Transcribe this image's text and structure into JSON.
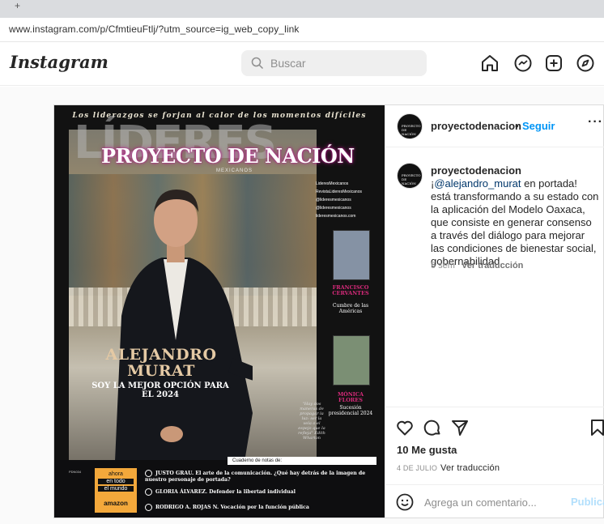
{
  "browser": {
    "new_tab": "+",
    "url": "www.instagram.com/p/CfmtieuFtlj/?utm_source=ig_web_copy_link"
  },
  "header": {
    "logo": "Instagram",
    "search_placeholder": "Buscar",
    "icons": [
      "home-icon",
      "messenger-icon",
      "new-post-icon",
      "explore-icon"
    ]
  },
  "post": {
    "cover": {
      "top_line": "Los liderazgos se forjan al calor de los momentos difíciles",
      "masthead": "LÍDERES",
      "brand": "PROYECTO DE NACIÓN",
      "brand_sub": "MEXICANOS",
      "social": [
        "LideresMexicanos",
        "RevistaLideresMexicanos",
        "@lideresmexicanos",
        "@lideresmexicanos",
        "lideresmexicanos.com"
      ],
      "headline": "ALEJANDRO MURAT",
      "subheadline": "SOY LA MEJOR OPCIÓN PARA EL 2024",
      "side1_name": "FRANCISCO CERVANTES",
      "side1_sub": "Cumbre de las Américas",
      "side2_name": "MÓNICA FLORES",
      "side2_sub": "Sucesión presidencial 2024",
      "quote": "\"Hay dos maneras de propagar la luz: ser la vela o el espejo que la refleja\" Edith Wharton",
      "notes_label": "Cuaderno de notas de:",
      "amazon_1": "ahora",
      "amazon_2": "en todo",
      "amazon_3": "el mundo",
      "amazon_4": "amazon",
      "issue_code": "PDN034",
      "toc": [
        "JUSTO GRAU. El arte de la comunicación. ¿Qué hay detrás de la imagen de nuestro personaje de portada?",
        "GLORIA ÁLVAREZ. Defender la libertad individual",
        "RODRIGO A. ROJAS N. Vocación por la función pública"
      ]
    },
    "author": {
      "username": "proyectodenacion",
      "separator": "•",
      "follow_label": "Seguir",
      "avatar_text": "PROYECTO DE NACIÓN",
      "more": "···"
    },
    "caption": {
      "username": "proyectodenacion",
      "prefix": " ¡",
      "mention": "@alejandro_murat",
      "text": " en portada! está transformando a su estado con la aplicación del Modelo Oaxaca, que consiste en generar consenso a través del diálogo para mejorar las condiciones de bienestar social, gobernabilidad.",
      "age": "5 sem",
      "translate": "Ver traducción"
    },
    "likes": "10 Me gusta",
    "date": "4 DE JULIO",
    "date_translate": "Ver traducción",
    "comment_placeholder": "Agrega un comentario...",
    "publish_label": "Publicar"
  }
}
